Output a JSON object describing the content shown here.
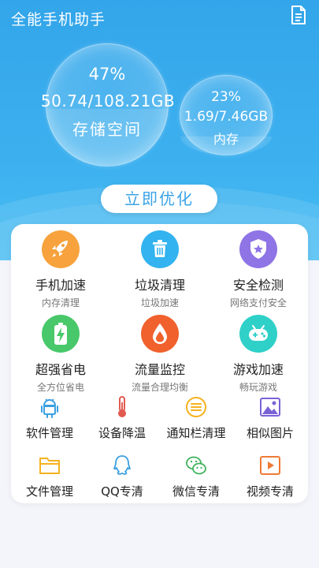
{
  "header": {
    "title": "全能手机助手",
    "icon": "document-icon"
  },
  "storage": {
    "percent": "47%",
    "usage": "50.74/108.21GB",
    "label": "存储空间",
    "fill": 0.47
  },
  "memory": {
    "percent": "23%",
    "usage": "1.69/7.46GB",
    "label": "内存",
    "fill": 0.23
  },
  "optimize_label": "立即优化",
  "features": [
    {
      "title": "手机加速",
      "sub": "内存清理",
      "icon": "rocket-icon",
      "color": "#f7a23c"
    },
    {
      "title": "垃圾清理",
      "sub": "垃圾加速",
      "icon": "trash-icon",
      "color": "#33b3ef"
    },
    {
      "title": "安全检测",
      "sub": "网络支付安全",
      "icon": "shield-star-icon",
      "color": "#8f74e6"
    },
    {
      "title": "超强省电",
      "sub": "全方位省电",
      "icon": "battery-icon",
      "color": "#48c86a"
    },
    {
      "title": "流量监控",
      "sub": "流量合理均衡",
      "icon": "drop-icon",
      "color": "#f0612d"
    },
    {
      "title": "游戏加速",
      "sub": "畅玩游戏",
      "icon": "gamepad-icon",
      "color": "#2fd0c8"
    }
  ],
  "tools": [
    {
      "label": "软件管理",
      "icon": "android-icon",
      "color": "#3a9fe0"
    },
    {
      "label": "设备降温",
      "icon": "thermometer-icon",
      "color": "#e25a4f"
    },
    {
      "label": "通知栏清理",
      "icon": "list-icon",
      "color": "#f5b21e"
    },
    {
      "label": "相似图片",
      "icon": "image-icon",
      "color": "#7b63d6"
    },
    {
      "label": "文件管理",
      "icon": "folder-icon",
      "color": "#f5b21e"
    },
    {
      "label": "QQ专清",
      "icon": "qq-icon",
      "color": "#3a9fe0"
    },
    {
      "label": "微信专清",
      "icon": "wechat-icon",
      "color": "#40b25c"
    },
    {
      "label": "视频专清",
      "icon": "video-icon",
      "color": "#f07a35"
    }
  ]
}
